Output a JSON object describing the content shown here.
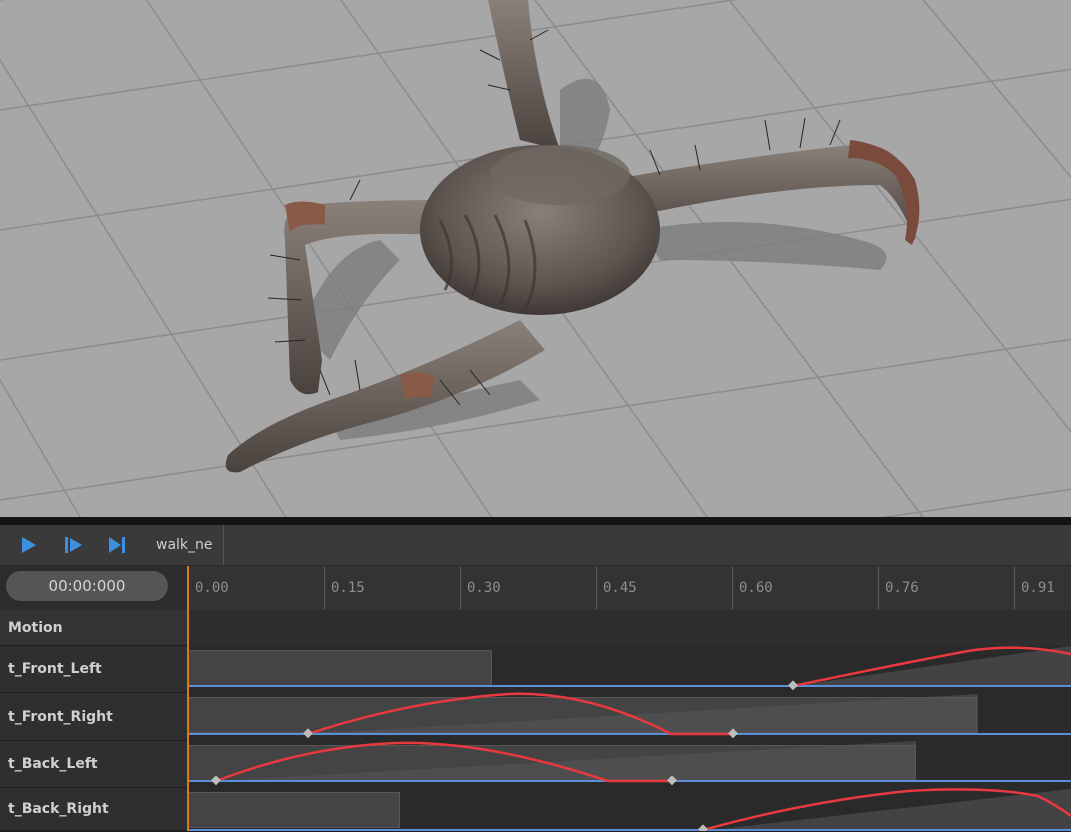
{
  "toolbar": {
    "animation_name": "walk_ne",
    "play_icon": "play-icon",
    "step_icon": "step-forward-icon",
    "end_icon": "skip-to-end-icon",
    "accent_color": "#3d8fe0"
  },
  "timeline": {
    "timecode": "00:00:000",
    "ruler_ticks": [
      "0.00",
      "0.15",
      "0.30",
      "0.45",
      "0.60",
      "0.76",
      "0.91"
    ],
    "motion_label": "Motion",
    "playhead_color": "#d97a1a",
    "curve_color": "#e8393f",
    "baseline_color": "#5a8fd8",
    "tracks": [
      {
        "label": "t_Front_Left"
      },
      {
        "label": "t_Front_Right"
      },
      {
        "label": "t_Back_Left"
      },
      {
        "label": "t_Back_Right"
      }
    ]
  },
  "viewport": {
    "floor_color": "#a9a9a9",
    "grid_color": "#8f8f8f"
  }
}
